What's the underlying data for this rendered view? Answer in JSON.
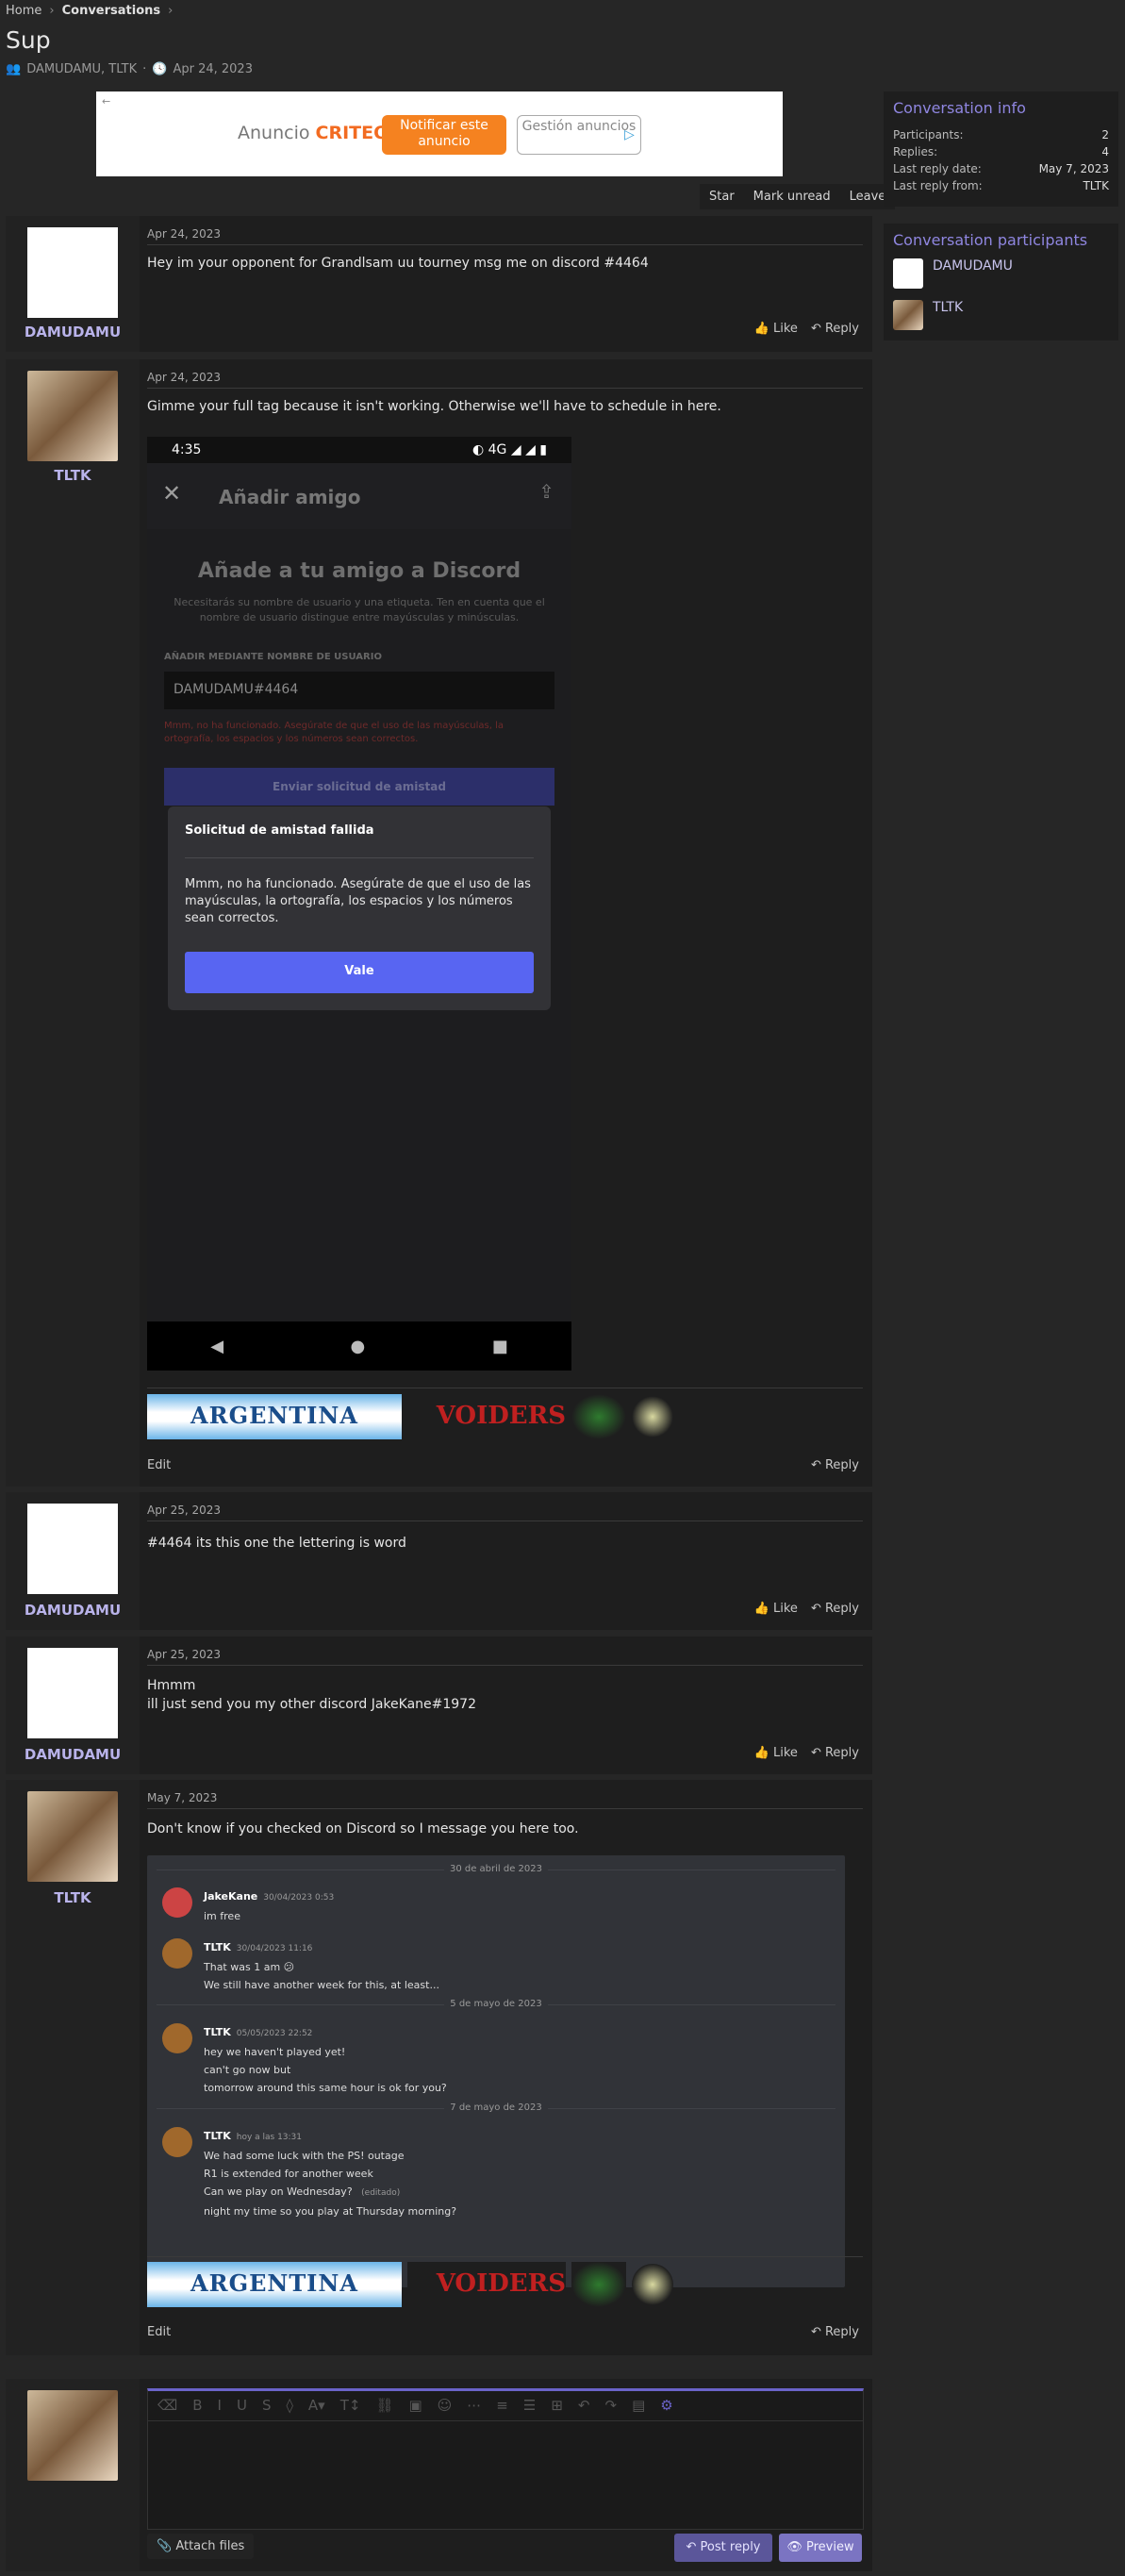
{
  "breadcrumb": {
    "home": "Home",
    "conversations": "Conversations"
  },
  "title": "Sup",
  "meta": {
    "participants": "DAMUDAMU, TLTK",
    "sep": "·",
    "date": "Apr 24, 2023"
  },
  "ad": {
    "anuncio": "Anuncio",
    "brand": "CRITEO",
    "btn1": "Notificar este anuncio",
    "btn2": "Gestión anuncios"
  },
  "actions": {
    "star": "Star",
    "mark_unread": "Mark unread",
    "leave": "Leave"
  },
  "info": {
    "heading": "Conversation info",
    "participants_label": "Participants:",
    "participants_value": "2",
    "replies_label": "Replies:",
    "replies_value": "4",
    "last_date_label": "Last reply date:",
    "last_date_value": "May 7, 2023",
    "last_from_label": "Last reply from:",
    "last_from_value": "TLTK"
  },
  "participants": {
    "heading": "Conversation participants",
    "items": [
      {
        "name": "DAMUDAMU"
      },
      {
        "name": "TLTK"
      }
    ]
  },
  "post_actions": {
    "like": "Like",
    "reply": "Reply",
    "edit": "Edit"
  },
  "posts": [
    {
      "user": "DAMUDAMU",
      "date": "Apr 24, 2023",
      "text": "Hey im your opponent for Grandlsam uu tourney msg me on discord #4464"
    },
    {
      "user": "TLTK",
      "date": "Apr 24, 2023",
      "text": "Gimme your full tag because it isn't working. Otherwise we'll have to schedule in here."
    },
    {
      "user": "DAMUDAMU",
      "date": "Apr 25, 2023",
      "text": "#4464 its this one the lettering is word"
    },
    {
      "user": "DAMUDAMU",
      "date": "Apr 25, 2023",
      "text1": "Hmmm",
      "text2": "ill just send you my other discord JakeKane#1972"
    },
    {
      "user": "TLTK",
      "date": "May 7, 2023",
      "text": "Don't know if you checked on Discord so I message you here too."
    }
  ],
  "phone": {
    "time": "4:35",
    "net": "4G",
    "title": "Añadir amigo",
    "heading": "Añade a tu amigo a Discord",
    "sub": "Necesitarás su nombre de usuario y una etiqueta. Ten en cuenta que el nombre de usuario distingue entre mayúsculas y minúsculas.",
    "label": "AÑADIR MEDIANTE NOMBRE DE USUARIO",
    "input": "DAMUDAMU#4464",
    "error": "Mmm, no ha funcionado. Asegúrate de que el uso de las mayúsculas, la ortografía, los espacios y los números sean correctos.",
    "send": "Enviar solicitud de amistad",
    "modal_title": "Solicitud de amistad fallida",
    "modal_body": "Mmm, no ha funcionado. Asegúrate de que el uso de las mayúsculas, la ortografía, los espacios y los números sean correctos.",
    "ok": "Vale"
  },
  "signature": {
    "team": "ARGENTINA",
    "voiders": "VOIDERS"
  },
  "chat": {
    "day1": "30 de abril de 2023",
    "day2": "5 de mayo de 2023",
    "day3": "7 de mayo de 2023",
    "m1": {
      "name": "JakeKane",
      "date": "30/04/2023 0:53",
      "lines": [
        "im free"
      ]
    },
    "m2": {
      "name": "TLTK",
      "date": "30/04/2023 11:16",
      "lines": [
        "That was 1 am 😕",
        "We still have another week for this, at least..."
      ]
    },
    "m3": {
      "name": "TLTK",
      "date": "05/05/2023 22:52",
      "lines": [
        "hey we haven't played yet!",
        "can't go now but",
        "tomorrow around this same hour is ok for you?"
      ]
    },
    "m4": {
      "name": "TLTK",
      "date": "hoy a las 13:31",
      "lines": [
        "We had some luck with the PS! outage",
        "R1 is extended for another week",
        "Can we play on Wednesday?",
        "night my time so you play at Thursday morning?"
      ]
    },
    "edited": "(editado)"
  },
  "reply": {
    "attach": "Attach files",
    "post": "Post reply",
    "preview": "Preview"
  }
}
